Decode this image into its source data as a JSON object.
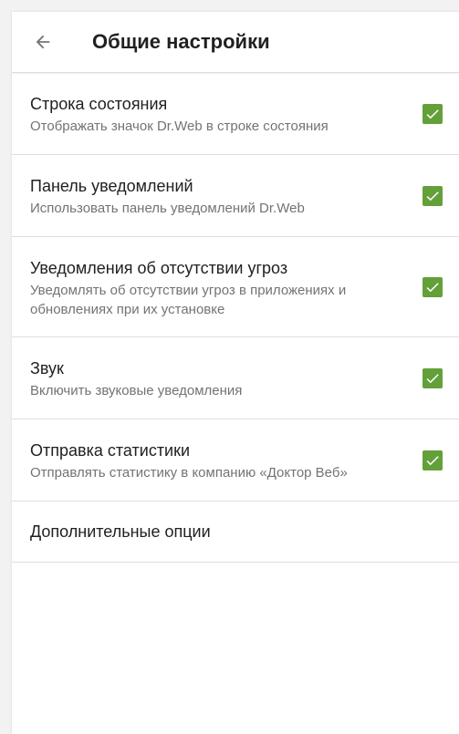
{
  "header": {
    "back_icon": "arrow-left-icon",
    "title": "Общие настройки"
  },
  "accent_color": "#64a03a",
  "settings": [
    {
      "label": "Строка состояния",
      "description": "Отображать значок Dr.Web в строке состояния",
      "checked": true
    },
    {
      "label": "Панель уведомлений",
      "description": "Использовать панель уведомлений Dr.Web",
      "checked": true
    },
    {
      "label": "Уведомления об отсутствии угроз",
      "description": "Уведомлять об отсутствии угроз в приложениях и обновлениях при их установке",
      "checked": true
    },
    {
      "label": "Звук",
      "description": "Включить звуковые уведомления",
      "checked": true
    },
    {
      "label": "Отправка статистики",
      "description": "Отправлять статистику в компанию «Доктор Веб»",
      "checked": true
    },
    {
      "label": "Дополнительные опции"
    }
  ]
}
